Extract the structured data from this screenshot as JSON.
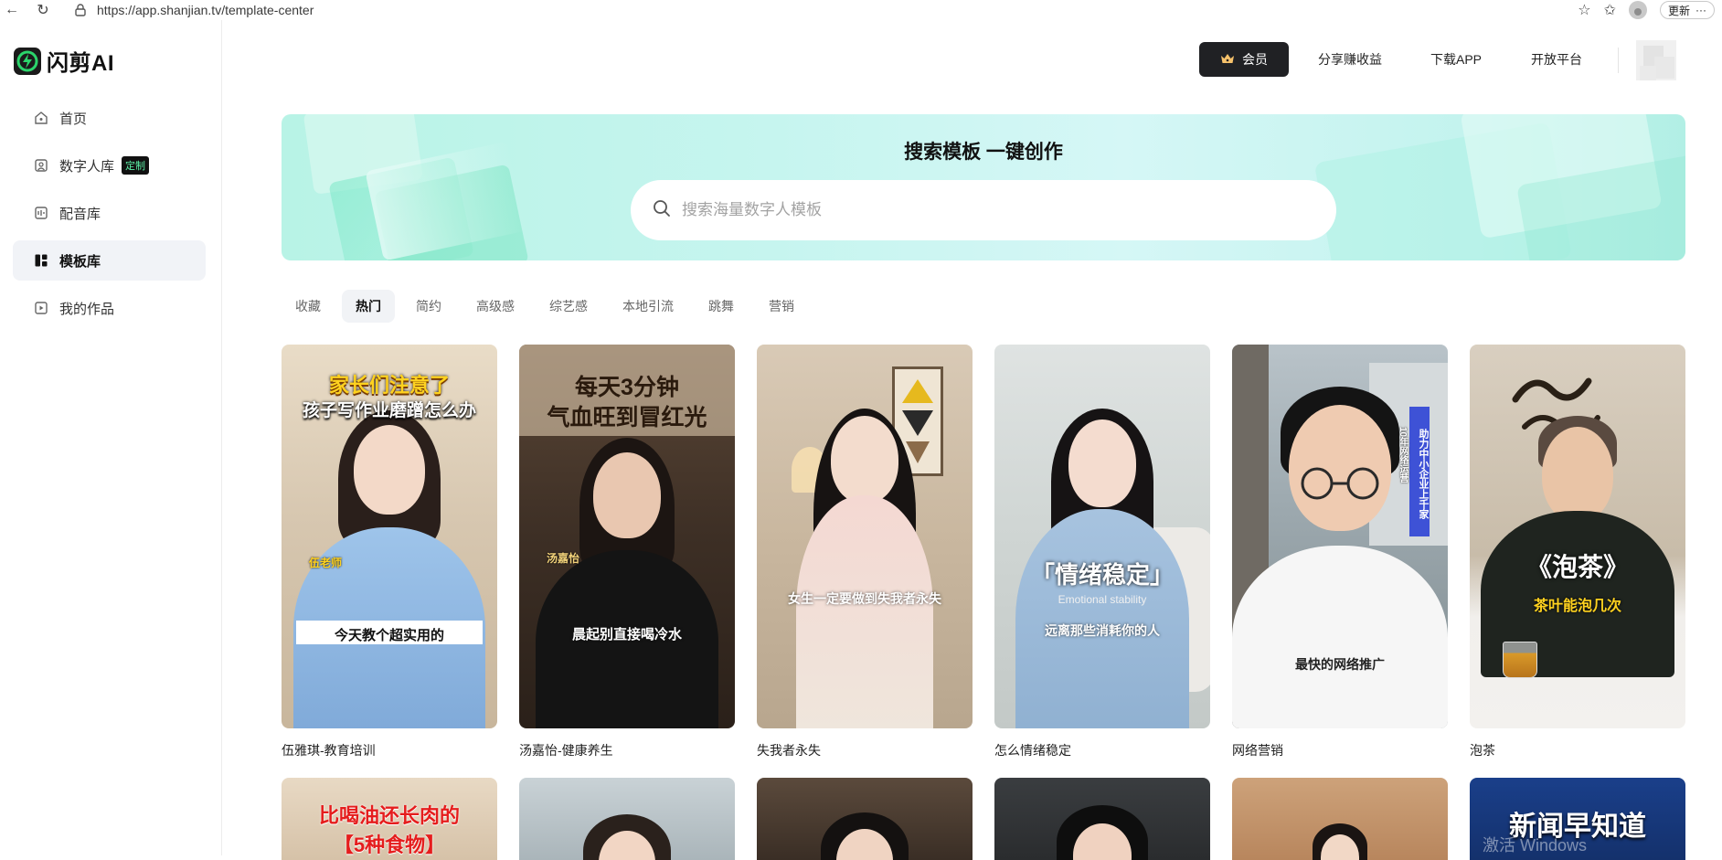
{
  "browser": {
    "url": "https://app.shanjian.tv/template-center",
    "update_label": "更新"
  },
  "app": {
    "logo_text": "闪剪AI",
    "brand_color": "#2bd56b"
  },
  "sidebar": {
    "items": [
      {
        "label": "首页",
        "icon": "home-icon"
      },
      {
        "label": "数字人库",
        "icon": "digital-human-icon",
        "badge": "定制"
      },
      {
        "label": "配音库",
        "icon": "voice-icon"
      },
      {
        "label": "模板库",
        "icon": "template-icon",
        "active": true
      },
      {
        "label": "我的作品",
        "icon": "works-icon"
      }
    ]
  },
  "header": {
    "vip_label": "会员",
    "links": [
      "分享赚收益",
      "下载APP",
      "开放平台"
    ]
  },
  "banner": {
    "title": "搜索模板 一键创作",
    "search_placeholder": "搜索海量数字人模板"
  },
  "tabs": [
    "收藏",
    "热门",
    "简约",
    "高级感",
    "综艺感",
    "本地引流",
    "跳舞",
    "营销"
  ],
  "active_tab": "热门",
  "templates": [
    {
      "title": "伍雅琪-教育培训",
      "cap1": "家长们注意了",
      "cap2": "孩子写作业磨蹭怎么办",
      "name": "伍老师",
      "subtitle": "今天教个超实用的"
    },
    {
      "title": "汤嘉怡-健康养生",
      "cap1": "每天3分钟",
      "cap2": "气血旺到冒红光",
      "name": "汤嘉怡",
      "subtitle": "晨起别直接喝冷水"
    },
    {
      "title": "失我者永失",
      "subtitle": "女生一定要做到失我者永失"
    },
    {
      "title": "怎么情绪稳定",
      "cap1": "「情绪稳定」",
      "cap2": "Emotional stability",
      "subtitle": "远离那些消耗你的人"
    },
    {
      "title": "网络营销",
      "side_banner": "助力中小企业上千家",
      "side_small": "10年网络运营",
      "subtitle": "最快的网络推广"
    },
    {
      "title": "泡茶",
      "cap1": "《泡茶》",
      "cap2": "茶叶能泡几次"
    }
  ],
  "row2": [
    {
      "cap1": "比喝油还长肉的",
      "cap2": "【5种食物】"
    },
    {},
    {},
    {},
    {},
    {
      "cap1": "新闻早知道",
      "watermark": "激活 Windows"
    }
  ]
}
